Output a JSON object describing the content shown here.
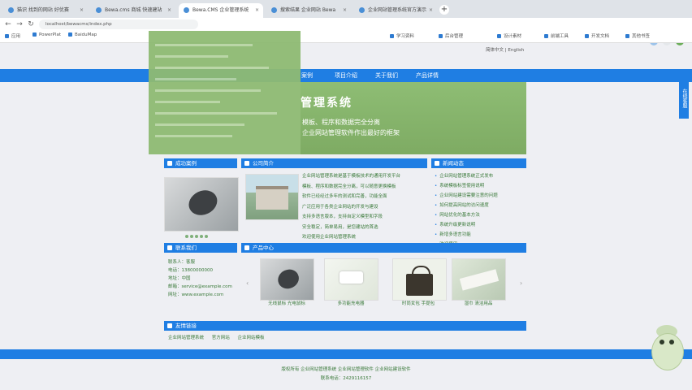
{
  "browser": {
    "tabs": [
      {
        "label": "猫识 找到的网站 好优赛"
      },
      {
        "label": "Bewa.cms 商城 快速建站"
      },
      {
        "label": "Bewa.CMS 企业管理系统"
      },
      {
        "label": "搜索结果 企业网站 Bewa"
      },
      {
        "label": "企业网站管理系统官方演示"
      }
    ],
    "url": "localhost/bewacms/index.php"
  },
  "bookmarks": [
    "应用",
    "PowerPlat",
    "BaiduMap",
    "学习资料",
    "后台管理",
    "设计素材",
    "前端工具",
    "开发文档",
    "其他书签"
  ],
  "lang": {
    "zh": "简体中文",
    "en": "English"
  },
  "nav": [
    "案例",
    "项目介绍",
    "关于我们",
    "产品详情"
  ],
  "banner": {
    "title": "管理系统",
    "line1": "模板、程序和数据完全分离",
    "line2": "企业网站管理软件作出最好的框架"
  },
  "side_tab": "在线客服",
  "sections": {
    "cases": "成功案例",
    "company": "公司简介",
    "news": "新闻动态",
    "contact": "联系我们",
    "products": "产品中心",
    "links": "友情链接"
  },
  "company_intro": [
    "企业网站管理系统是基于模板技术的通用开发平台",
    "模板、程序和数据完全分离，可以随意更换模板",
    "软件已经经过多年的测试和完善，功能全面",
    "广泛应用于各类企业网站的开发与建设",
    "支持多语言版本，支持自定义模型和字段",
    "安全稳定，简单易用，是您建站的首选",
    "欢迎使用企业网站管理系统"
  ],
  "news": [
    "企业网站管理系统正式发布",
    "系统模板标签使用说明",
    "企业网站建设需要注意的问题",
    "如何提高网站的访问速度",
    "网站优化的基本方法",
    "系统升级更新说明",
    "新增多语言功能",
    "欢迎使用"
  ],
  "contact": {
    "lines": [
      "联系人：客服",
      "电话：13800000000",
      "地址：中国",
      "邮箱：service@example.com",
      "网址：www.example.com"
    ]
  },
  "products": [
    {
      "name": "无线鼠标 光电鼠标"
    },
    {
      "name": "多功能充电器"
    },
    {
      "name": "时尚女包 手提包"
    },
    {
      "name": "湿巾 清洁用品"
    }
  ],
  "links": [
    "企业网站管理系统",
    "官方网站",
    "企业网站模板"
  ],
  "footer": {
    "line1": "版权所有 企业网站管理系统 企业网站管理软件 企业网站建设软件",
    "line2": "联系电话：2429116157"
  }
}
